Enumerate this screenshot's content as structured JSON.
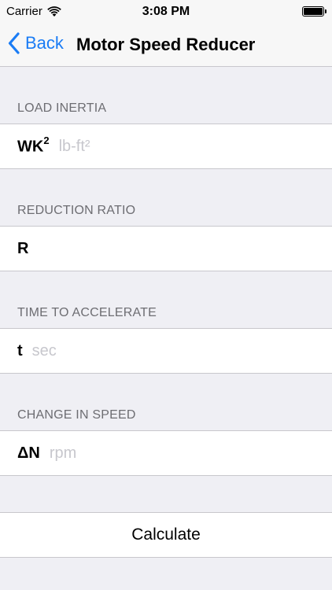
{
  "status_bar": {
    "carrier": "Carrier",
    "time": "3:08 PM"
  },
  "nav": {
    "back_label": "Back",
    "title": "Motor Speed Reducer",
    "accent_color": "#1a7cf5"
  },
  "sections": [
    {
      "header": "LOAD INERTIA",
      "label": "WK",
      "label_sup": "2",
      "value": "",
      "placeholder": "lb-ft²"
    },
    {
      "header": "REDUCTION RATIO",
      "label": "R",
      "label_sup": "",
      "value": "",
      "placeholder": ""
    },
    {
      "header": "TIME TO ACCELERATE",
      "label": "t",
      "label_sup": "",
      "value": "",
      "placeholder": "sec"
    },
    {
      "header": "CHANGE IN SPEED",
      "label": "ΔN",
      "label_sup": "",
      "value": "",
      "placeholder": "rpm"
    }
  ],
  "calculate_label": "Calculate",
  "icons": {
    "wifi": "wifi-icon",
    "battery": "battery-icon",
    "back": "chevron-left-icon"
  }
}
